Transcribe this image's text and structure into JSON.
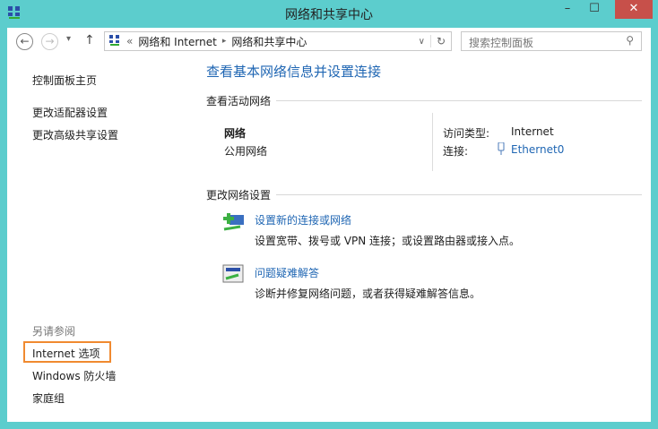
{
  "window": {
    "title": "网络和共享中心",
    "minimize": "–",
    "maximize": "☐",
    "close": "✕"
  },
  "nav": {
    "back": "←",
    "forward": "→",
    "recent": "▾",
    "up": "↑",
    "breadcrumb_sep": "«",
    "crumb1": "网络和 Internet",
    "arrow": "▸",
    "crumb2": "网络和共享中心",
    "dropdown": "∨",
    "refresh": "↻",
    "search_placeholder": "搜索控制面板",
    "search_icon": "⚲"
  },
  "sidebar": {
    "home": "控制面板主页",
    "adapter": "更改适配器设置",
    "advanced": "更改高级共享设置",
    "see_also": "另请参阅",
    "internet_options": "Internet 选项",
    "firewall": "Windows 防火墙",
    "homegroup": "家庭组"
  },
  "main": {
    "heading": "查看基本网络信息并设置连接",
    "active_title": "查看活动网络",
    "network_name": "网络",
    "network_type": "公用网络",
    "access_label": "访问类型:",
    "access_value": "Internet",
    "conn_label": "连接:",
    "conn_value": "Ethernet0",
    "change_title": "更改网络设置",
    "items": [
      {
        "title": "设置新的连接或网络",
        "desc": "设置宽带、拨号或 VPN 连接；或设置路由器或接入点。"
      },
      {
        "title": "问题疑难解答",
        "desc": "诊断并修复网络问题，或者获得疑难解答信息。"
      }
    ]
  }
}
